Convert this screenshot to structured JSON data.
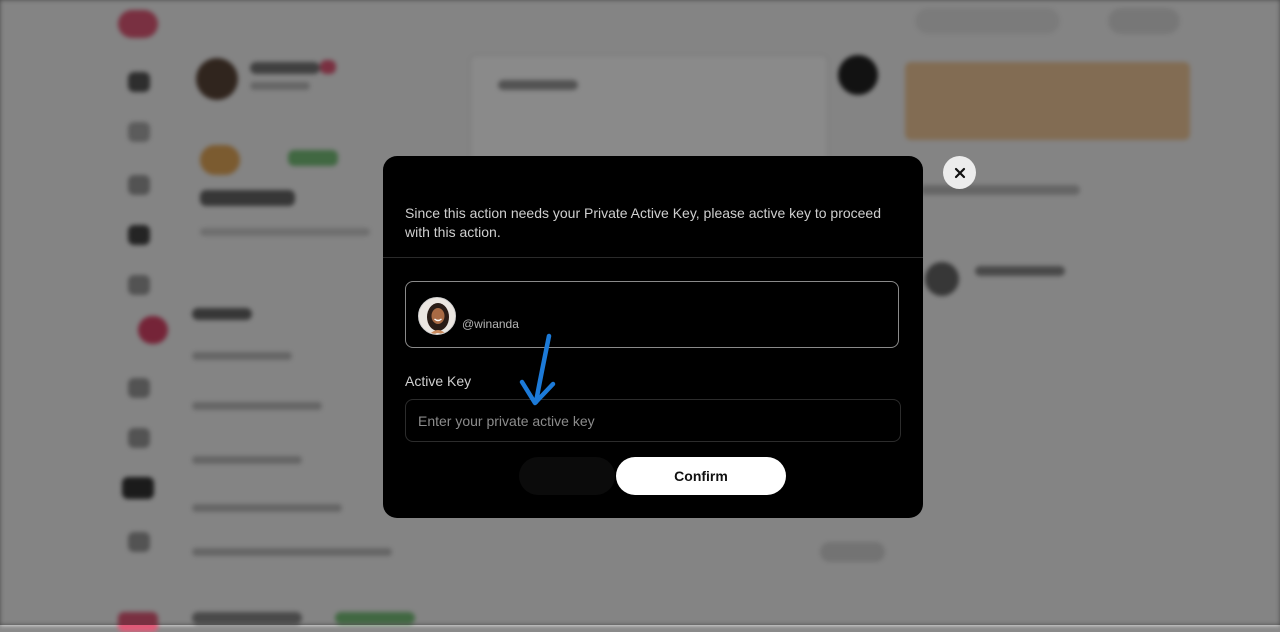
{
  "modal": {
    "message": "Since this action needs your Private Active Key, please active key to proceed with this action.",
    "account": {
      "username": "@winanda",
      "avatar_icon": "user-avatar-photo"
    },
    "active_key": {
      "label": "Active Key",
      "placeholder": "Enter your private active key",
      "value": ""
    },
    "confirm_label": "Confirm",
    "close_icon": "close-icon"
  },
  "annotation": {
    "icon": "hand-drawn-arrow-down",
    "color": "#1c7ad8"
  },
  "colors": {
    "modal_bg": "#000000",
    "confirm_bg": "#ffffff",
    "accent_brand": "#d94468"
  }
}
